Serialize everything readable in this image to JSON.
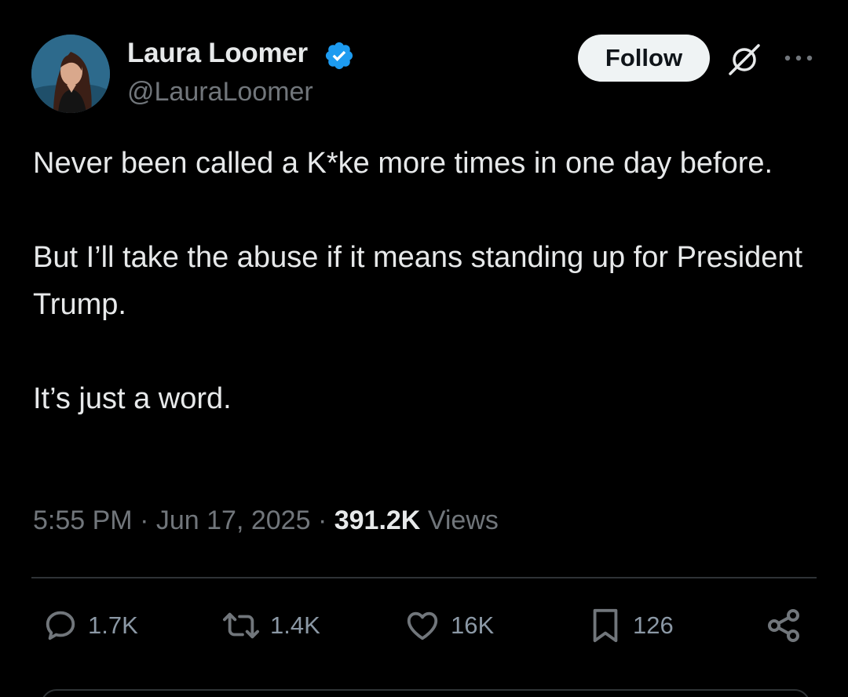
{
  "author": {
    "display_name": "Laura Loomer",
    "handle": "@LauraLoomer",
    "verified": true,
    "verified_color": "#1d9bf0"
  },
  "header": {
    "follow_label": "Follow",
    "grok_icon": "grok-icon",
    "more_icon": "more-options-icon"
  },
  "tweet": {
    "paragraphs": [
      "Never been called a K*ke more times in one day before.",
      "But I’ll take the abuse if it means standing up for President Trump.",
      "It’s just a word."
    ],
    "time": "5:55 PM",
    "separator": "·",
    "date": "Jun 17, 2025",
    "views_count": "391.2K",
    "views_label": "Views"
  },
  "actions": {
    "reply_count": "1.7K",
    "repost_count": "1.4K",
    "like_count": "16K",
    "bookmark_count": "126"
  },
  "colors": {
    "background": "#000000",
    "text_primary": "#e7e9ea",
    "text_secondary": "#71767b",
    "divider": "#2f3336",
    "button_bg": "#eff3f4"
  }
}
